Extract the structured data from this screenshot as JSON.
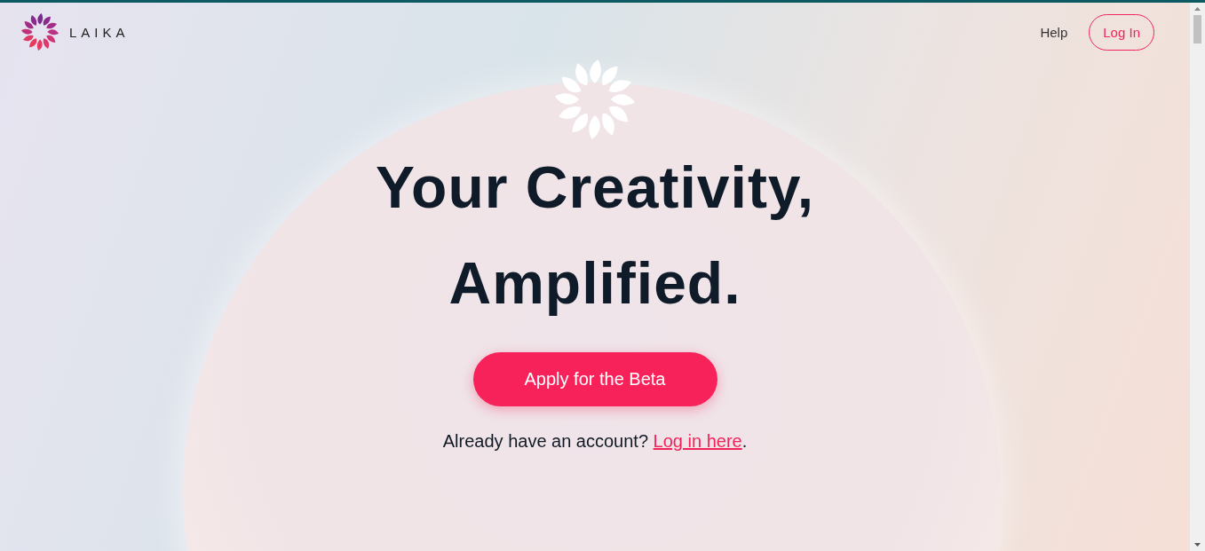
{
  "header": {
    "brand": "LAIKA",
    "nav": [
      {
        "kind": "link",
        "label": "Help"
      },
      {
        "kind": "outline",
        "label": "Log In"
      }
    ]
  },
  "hero": {
    "title_lines": [
      "Your Creativity,",
      "Amplified."
    ],
    "cta": "Apply for the Beta",
    "login_prompt": {
      "text": "Already have an account? ",
      "link": "Log in here",
      "end": "."
    }
  }
}
